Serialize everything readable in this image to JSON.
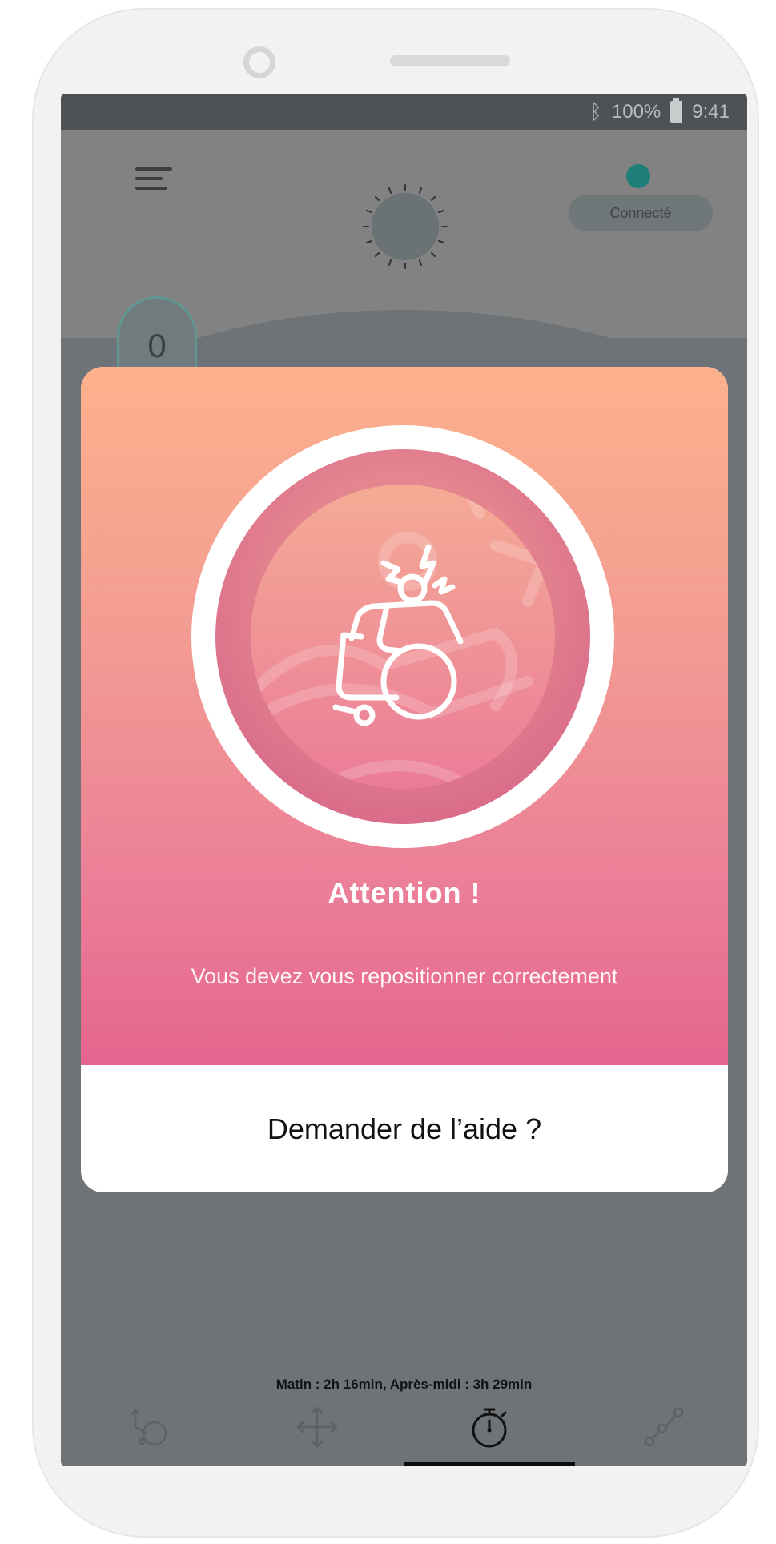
{
  "status_bar": {
    "bluetooth_icon": "bluetooth-icon",
    "battery": "100%",
    "time": "9:41"
  },
  "header": {
    "menu_icon": "menu-icon",
    "sun_icon": "sun-icon",
    "connection_status": "Connecté",
    "connection_color": "#1e7f7a"
  },
  "counter": {
    "value": "0"
  },
  "alert": {
    "icon": "wheelchair-alert-icon",
    "title": "Attention !",
    "message": "Vous devez vous repositionner correctement",
    "action_label": "Demander de l’aide ?",
    "gradient_top": "#fdb18c",
    "gradient_bottom": "#e5658e"
  },
  "summary_text": "Matin : 2h 16min, Après-midi : 3h 29min",
  "bottom_nav": {
    "items": [
      {
        "icon": "wheelchair-tilt-icon"
      },
      {
        "icon": "move-arrows-icon"
      },
      {
        "icon": "stopwatch-icon"
      },
      {
        "icon": "graph-icon"
      }
    ]
  }
}
